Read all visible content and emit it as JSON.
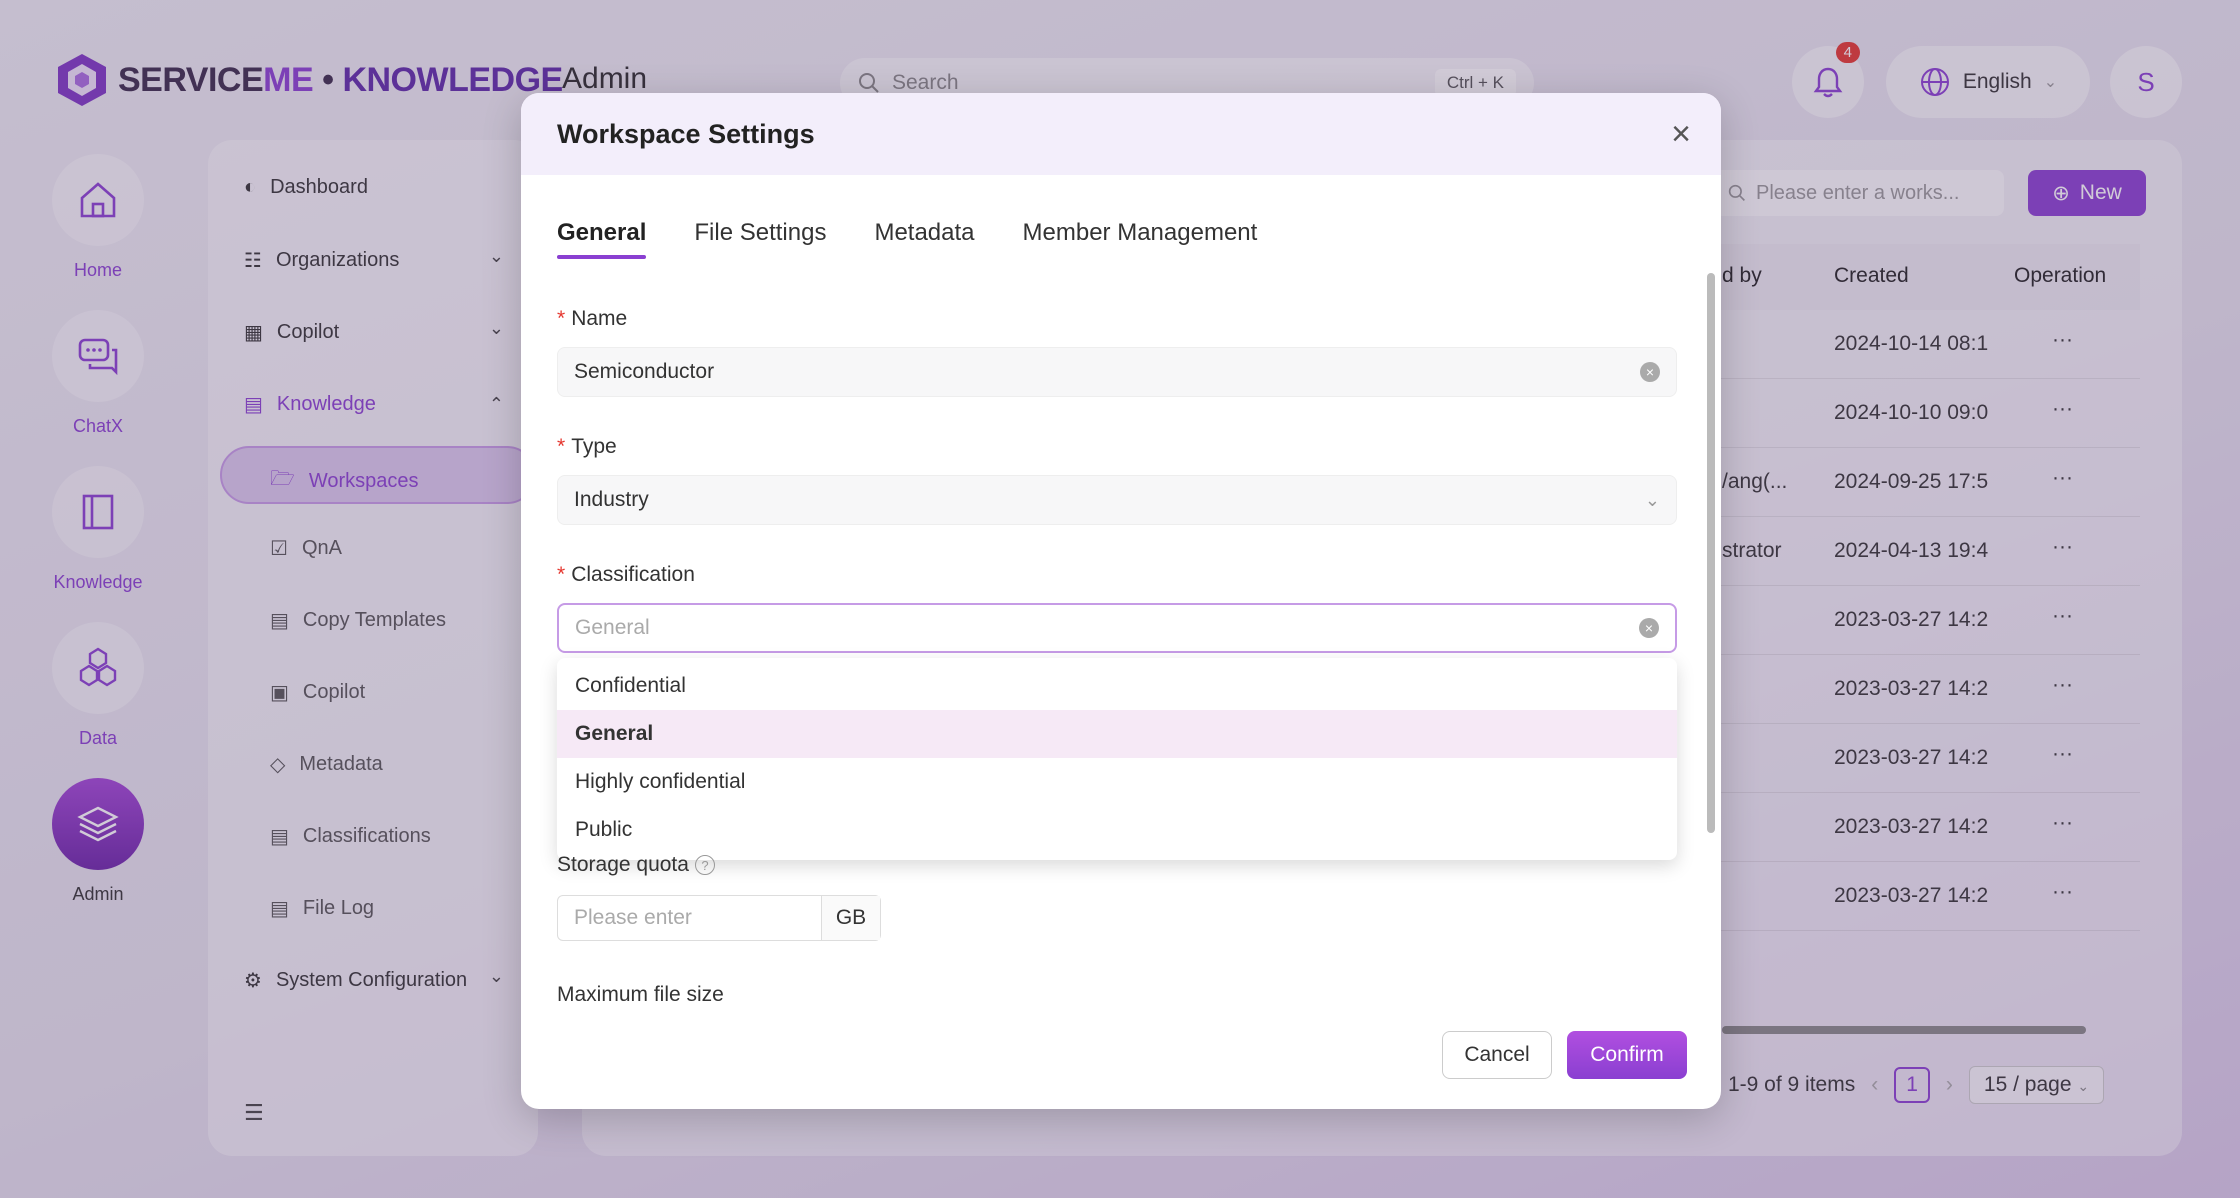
{
  "header": {
    "logo_text_1": "SERVICE",
    "logo_text_2": "ME",
    "logo_text_3": " • ",
    "logo_text_4": "KNOWLEDGE",
    "section_title": "Admin",
    "search_placeholder": "Search",
    "search_shortcut": "Ctrl + K",
    "notification_count": "4",
    "language": "English",
    "avatar_initial": "S"
  },
  "rail": {
    "items": [
      {
        "label": "Home",
        "icon": "home-icon"
      },
      {
        "label": "ChatX",
        "icon": "chat-icon"
      },
      {
        "label": "Knowledge",
        "icon": "book-icon"
      },
      {
        "label": "Data",
        "icon": "hexagons-icon"
      },
      {
        "label": "Admin",
        "icon": "layers-icon"
      }
    ]
  },
  "sidebar": {
    "items": [
      {
        "label": "Dashboard"
      },
      {
        "label": "Organizations"
      },
      {
        "label": "Copilot"
      },
      {
        "label": "Knowledge"
      },
      {
        "label": "Workspaces"
      },
      {
        "label": "QnA"
      },
      {
        "label": "Copy Templates"
      },
      {
        "label": "Copilot"
      },
      {
        "label": "Metadata"
      },
      {
        "label": "Classifications"
      },
      {
        "label": "File Log"
      },
      {
        "label": "System Configuration"
      }
    ]
  },
  "panel": {
    "search_placeholder": "Please enter a works...",
    "new_label": "New",
    "columns": [
      "d by",
      "Created",
      "Operation"
    ],
    "rows": [
      {
        "by": "",
        "created": "2024-10-14 08:1",
        "op": "···"
      },
      {
        "by": "",
        "created": "2024-10-10 09:0",
        "op": "···"
      },
      {
        "by": "/ang(...",
        "created": "2024-09-25 17:5",
        "op": "···"
      },
      {
        "by": "strator",
        "created": "2024-04-13 19:4",
        "op": "···"
      },
      {
        "by": "",
        "created": "2023-03-27 14:2",
        "op": "···"
      },
      {
        "by": "",
        "created": "2023-03-27 14:2",
        "op": "···"
      },
      {
        "by": "",
        "created": "2023-03-27 14:2",
        "op": "···"
      },
      {
        "by": "",
        "created": "2023-03-27 14:2",
        "op": "···"
      },
      {
        "by": "",
        "created": "2023-03-27 14:2",
        "op": "···"
      }
    ],
    "pagination": {
      "summary": "1-9 of 9 items",
      "current_page": "1",
      "page_size": "15 / page"
    }
  },
  "modal": {
    "title": "Workspace Settings",
    "tabs": [
      "General",
      "File Settings",
      "Metadata",
      "Member Management"
    ],
    "name_label": "Name",
    "name_value": "Semiconductor",
    "type_label": "Type",
    "type_value": "Industry",
    "classification_label": "Classification",
    "classification_placeholder": "General",
    "classification_options": [
      "Confidential",
      "General",
      "Highly confidential",
      "Public"
    ],
    "storage_quota_label": "Storage quota",
    "storage_quota_placeholder": "Please enter",
    "storage_quota_unit": "GB",
    "max_file_size_label": "Maximum file size",
    "cancel_label": "Cancel",
    "confirm_label": "Confirm"
  },
  "colors": {
    "accent": "#8a3fd1",
    "required": "#e5372f",
    "selected_option_bg": "#f6e9f6"
  }
}
